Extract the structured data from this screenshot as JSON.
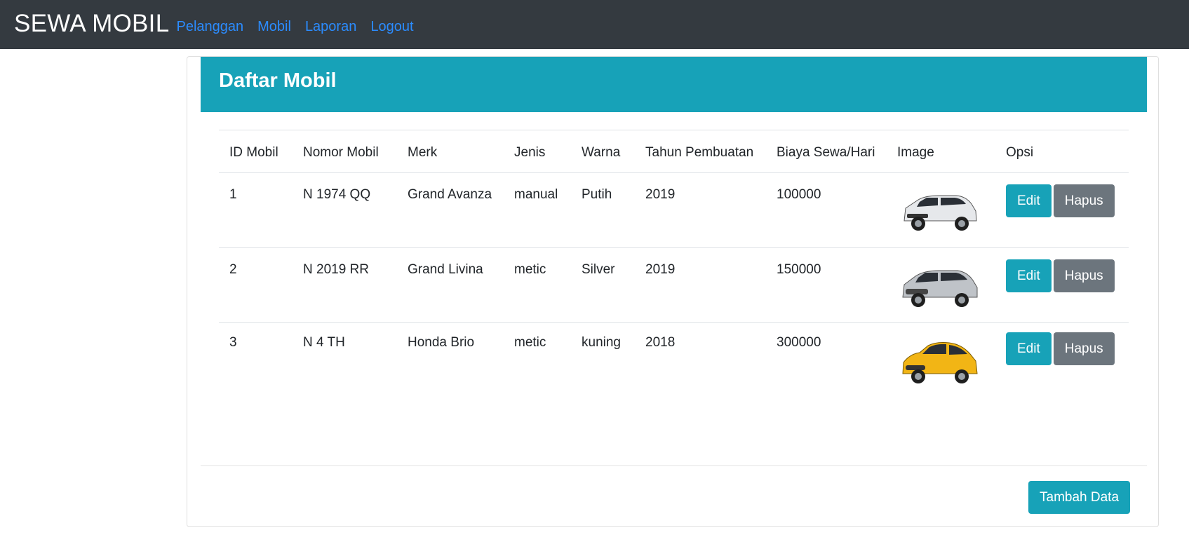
{
  "navbar": {
    "brand": "SEWA MOBIL",
    "links": [
      "Pelanggan",
      "Mobil",
      "Laporan",
      "Logout"
    ]
  },
  "card": {
    "title": "Daftar Mobil",
    "columns": [
      "ID Mobil",
      "Nomor Mobil",
      "Merk",
      "Jenis",
      "Warna",
      "Tahun Pembuatan",
      "Biaya Sewa/Hari",
      "Image",
      "Opsi"
    ],
    "rows": [
      {
        "id": "1",
        "nomor": "N 1974 QQ",
        "merk": "Grand Avanza",
        "jenis": "manual",
        "warna": "Putih",
        "tahun": "2019",
        "biaya": "100000",
        "image_color": "#e6e8eb"
      },
      {
        "id": "2",
        "nomor": "N 2019 RR",
        "merk": "Grand Livina",
        "jenis": "metic",
        "warna": "Silver",
        "tahun": "2019",
        "biaya": "150000",
        "image_color": "#bfc3c8"
      },
      {
        "id": "3",
        "nomor": "N 4 TH",
        "merk": "Honda Brio",
        "jenis": "metic",
        "warna": "kuning",
        "tahun": "2018",
        "biaya": "300000",
        "image_color": "#f2b515"
      }
    ],
    "edit_label": "Edit",
    "delete_label": "Hapus",
    "add_label": "Tambah Data"
  },
  "colors": {
    "navbar_bg": "#343a40",
    "link": "#2b8cff",
    "info": "#17a2b8",
    "secondary": "#6c757d"
  }
}
